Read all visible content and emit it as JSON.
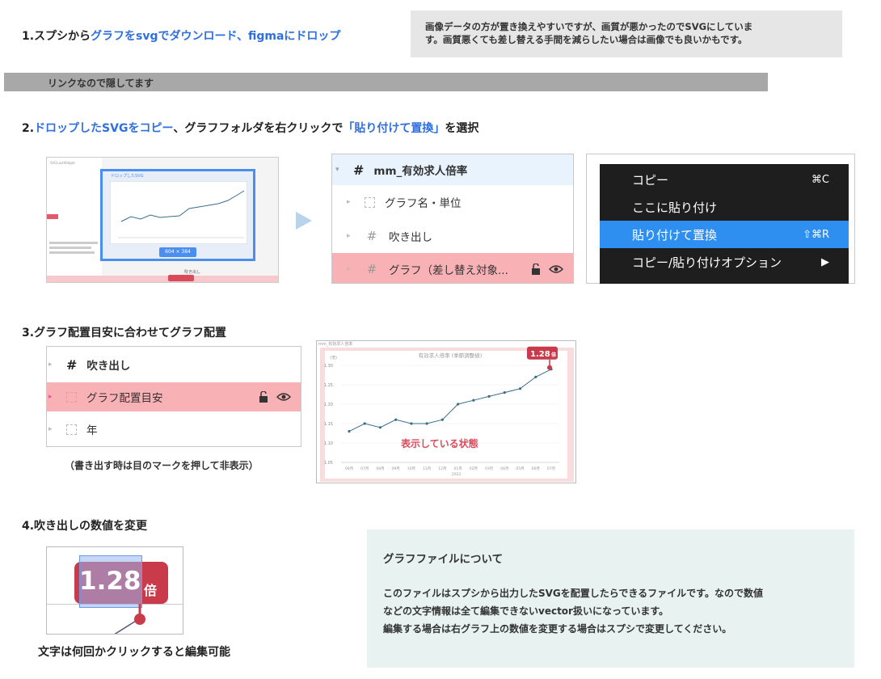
{
  "step1": {
    "prefix": "1.スプシから",
    "blue": "グラフをsvgでダウンロード、figmaにドロップ",
    "note_line1": "画像データの方が置き換えやすいですが、画質が悪かったのでSVGにしていま",
    "note_line2": "す。画質悪くても差し替える手間を減らしたい場合は画像でも良いかもです。",
    "hidden_bar_text": "リンクなので隠してます"
  },
  "step2": {
    "prefix": "2.",
    "blue1": "ドロップしたSVGをコピー",
    "mid": "、グラフフォルダを右クリックで",
    "blue2": "「貼り付けて置換」",
    "suffix": "を選択",
    "thumb": {
      "top_label": "SVGLastWidget",
      "frame_label": "ドロップしたSVG",
      "size_badge": "604 × 384",
      "bottom_label": "吹き出し"
    },
    "layers": {
      "header": "mm_有効求人倍率",
      "row1": "グラフ名・単位",
      "row2": "吹き出し",
      "row3": "グラフ（差し替え対象..."
    },
    "context_menu": {
      "copy": "コピー",
      "copy_sc": "⌘C",
      "paste_here": "ここに貼り付け",
      "paste_replace": "貼り付けて置換",
      "paste_replace_sc": "⇧⌘R",
      "copy_paste_options": "コピー/貼り付けオプション",
      "submenu_arrow": "▶"
    }
  },
  "step3": {
    "title": "3.グラフ配置目安に合わせてグラフ配置",
    "layers": {
      "row1": "吹き出し",
      "row2": "グラフ配置目安",
      "row3": "年"
    },
    "caption": "（書き出す時は目のマークを押して非表示）",
    "chart_frame_label": "mm_有効求人倍率",
    "status_text": "表示している状態"
  },
  "step4": {
    "title": "4.吹き出しの数値を変更",
    "bubble_value": "1.28",
    "bubble_unit": "倍",
    "caption": "文字は何回かクリックすると編集可能"
  },
  "info": {
    "title": "グラフファイルについて",
    "line1": "このファイルはスプシから出力したSVGを配置したらできるファイルです。なので数値",
    "line2": "などの文字情報は全て編集できないvector扱いになっています。",
    "line3": "編集する場合は右グラフ上の数値を変更する場合はスプシで変更してください。"
  },
  "colors": {
    "accent_blue": "#2f6fe0",
    "highlight_pink": "#f8b2b6",
    "bubble_red": "#c93a4a",
    "menu_active": "#2e8ff0",
    "info_bg": "#e8f3f1"
  },
  "chart_data": [
    {
      "type": "line",
      "title": "有効求人倍率",
      "subtitle": "(季節調整値)",
      "unit_label": "(倍)",
      "x": [
        "06月",
        "07月",
        "08月",
        "09月",
        "10月",
        "11月",
        "12月",
        "01月",
        "02月",
        "03月",
        "04月",
        "05月",
        "06月",
        "07月"
      ],
      "year_label": "2022",
      "values": [
        1.13,
        1.15,
        1.14,
        1.16,
        1.15,
        1.15,
        1.16,
        1.2,
        1.21,
        1.22,
        1.23,
        1.24,
        1.27,
        1.29
      ],
      "yticks": [
        1.05,
        1.1,
        1.15,
        1.2,
        1.25,
        1.3
      ],
      "ylim": [
        1.05,
        1.3
      ],
      "callout": "1.28",
      "callout_unit": "倍"
    }
  ]
}
